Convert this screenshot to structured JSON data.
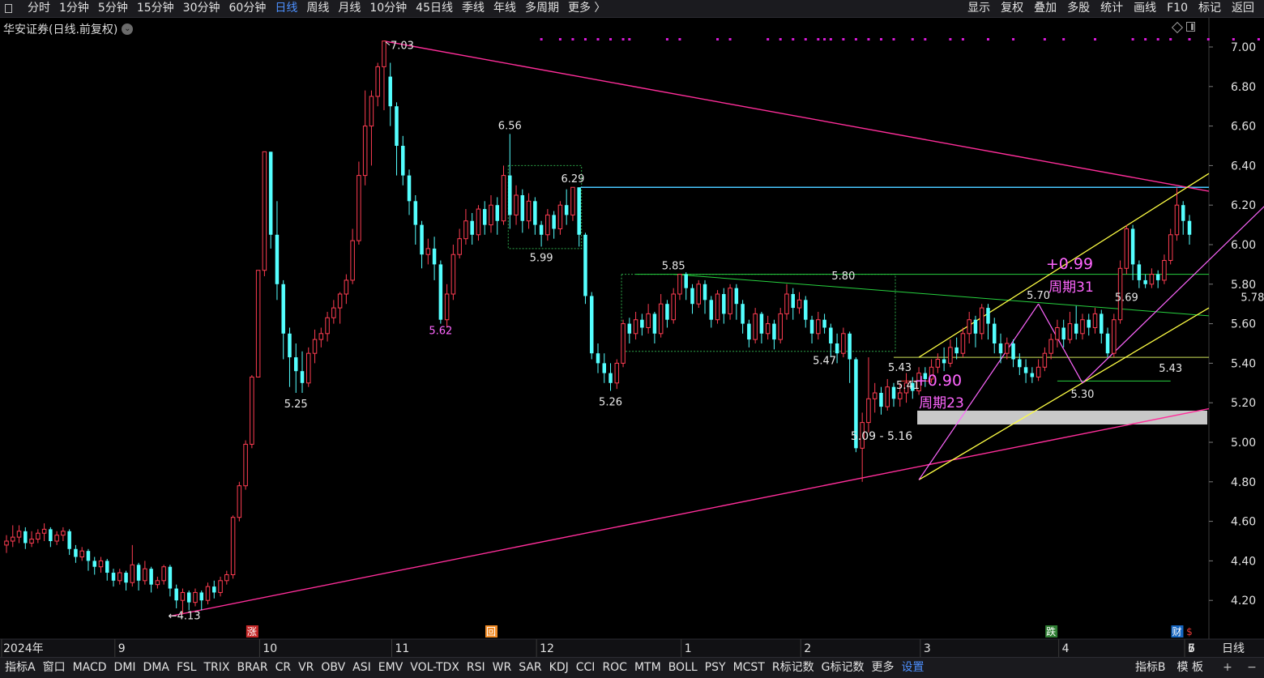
{
  "toolbar": {
    "periods": [
      "分时",
      "1分钟",
      "5分钟",
      "15分钟",
      "30分钟",
      "60分钟",
      "日线",
      "周线",
      "月线",
      "10分钟",
      "45日线",
      "季线",
      "年线",
      "多周期",
      "更多 〉"
    ],
    "active_period": "日线",
    "right_buttons": [
      "显示",
      "复权",
      "叠加",
      "多股",
      "统计",
      "画线",
      "F10",
      "标记",
      "返回"
    ]
  },
  "stock_title": "华安证券(日线.前复权)",
  "axis_period_label": "日线",
  "indicator_tabs": [
    "指标A",
    "窗口",
    "MACD",
    "DMI",
    "DMA",
    "FSL",
    "TRIX",
    "BRAR",
    "CR",
    "VR",
    "OBV",
    "ASI",
    "EMV",
    "VOL-TDX",
    "RSI",
    "WR",
    "SAR",
    "KDJ",
    "CCI",
    "ROC",
    "MTM",
    "BOLL",
    "PSY",
    "MCST",
    "R标记数",
    "G标记数",
    "更多",
    "设置"
  ],
  "indicator_right": [
    "指标B",
    "模 板",
    "+",
    "−"
  ],
  "event_markers": [
    {
      "label": "涨",
      "x_label": "10",
      "color": "#c62828"
    },
    {
      "label": "回",
      "x_label": "12",
      "color": "#f08a24"
    },
    {
      "label": "跌",
      "x_label": "4",
      "color": "#2e7d32"
    },
    {
      "label": "财",
      "x_label": "5",
      "color": "#1565c0"
    },
    {
      "label": "$",
      "x_label": "7",
      "color": "#e53935"
    }
  ],
  "chart_data": {
    "type": "candlestick",
    "ylim": [
      4.1,
      7.1
    ],
    "y_ticks": [
      "7.00",
      "6.80",
      "6.60",
      "6.40",
      "6.20",
      "6.00",
      "5.80",
      "5.60",
      "5.40",
      "5.20",
      "5.00",
      "4.80",
      "4.60",
      "4.40",
      "4.20"
    ],
    "x_labels": [
      "2024年",
      "9",
      "10",
      "11",
      "12",
      "1",
      "2",
      "3",
      "4",
      "5",
      "6",
      "7"
    ],
    "up_color": "#ff3d52",
    "down_color": "#54ffff",
    "candles": [
      [
        4.48,
        4.5,
        4.44,
        4.53
      ],
      [
        4.5,
        4.52,
        4.47,
        4.58
      ],
      [
        4.52,
        4.55,
        4.49,
        4.58
      ],
      [
        4.55,
        4.49,
        4.46,
        4.57
      ],
      [
        4.49,
        4.51,
        4.47,
        4.55
      ],
      [
        4.51,
        4.54,
        4.49,
        4.56
      ],
      [
        4.54,
        4.56,
        4.5,
        4.59
      ],
      [
        4.56,
        4.5,
        4.47,
        4.57
      ],
      [
        4.5,
        4.53,
        4.48,
        4.55
      ],
      [
        4.53,
        4.55,
        4.5,
        4.57
      ],
      [
        4.55,
        4.46,
        4.43,
        4.56
      ],
      [
        4.46,
        4.42,
        4.39,
        4.48
      ],
      [
        4.42,
        4.45,
        4.4,
        4.47
      ],
      [
        4.45,
        4.4,
        4.35,
        4.46
      ],
      [
        4.4,
        4.37,
        4.33,
        4.42
      ],
      [
        4.37,
        4.4,
        4.34,
        4.42
      ],
      [
        4.4,
        4.34,
        4.3,
        4.41
      ],
      [
        4.34,
        4.3,
        4.27,
        4.36
      ],
      [
        4.3,
        4.34,
        4.28,
        4.36
      ],
      [
        4.34,
        4.29,
        4.25,
        4.35
      ],
      [
        4.29,
        4.38,
        4.27,
        4.48
      ],
      [
        4.38,
        4.3,
        4.25,
        4.39
      ],
      [
        4.3,
        4.36,
        4.28,
        4.4
      ],
      [
        4.36,
        4.28,
        4.24,
        4.37
      ],
      [
        4.28,
        4.3,
        4.26,
        4.32
      ],
      [
        4.3,
        4.37,
        4.28,
        4.38
      ],
      [
        4.37,
        4.26,
        4.22,
        4.38
      ],
      [
        4.26,
        4.2,
        4.16,
        4.28
      ],
      [
        4.2,
        4.24,
        4.13,
        4.26
      ],
      [
        4.24,
        4.19,
        4.15,
        4.25
      ],
      [
        4.19,
        4.24,
        4.17,
        4.26
      ],
      [
        4.24,
        4.2,
        4.15,
        4.25
      ],
      [
        4.2,
        4.27,
        4.18,
        4.29
      ],
      [
        4.27,
        4.24,
        4.21,
        4.3
      ],
      [
        4.24,
        4.3,
        4.22,
        4.32
      ],
      [
        4.3,
        4.33,
        4.28,
        4.35
      ],
      [
        4.33,
        4.62,
        4.31,
        4.63
      ],
      [
        4.62,
        4.78,
        4.6,
        4.8
      ],
      [
        4.78,
        4.99,
        4.76,
        5.01
      ],
      [
        4.99,
        5.33,
        4.97,
        5.34
      ],
      [
        5.33,
        5.87,
        5.55,
        5.87
      ],
      [
        5.87,
        6.47,
        5.84,
        6.47
      ],
      [
        6.47,
        6.05,
        5.98,
        6.47
      ],
      [
        6.05,
        5.8,
        5.72,
        6.22
      ],
      [
        5.8,
        5.55,
        5.42,
        5.82
      ],
      [
        5.55,
        5.43,
        5.28,
        5.58
      ],
      [
        5.43,
        5.36,
        5.25,
        5.5
      ],
      [
        5.36,
        5.3,
        5.25,
        5.46
      ],
      [
        5.3,
        5.45,
        5.28,
        5.48
      ],
      [
        5.45,
        5.52,
        5.4,
        5.57
      ],
      [
        5.52,
        5.55,
        5.48,
        5.58
      ],
      [
        5.55,
        5.63,
        5.51,
        5.66
      ],
      [
        5.63,
        5.68,
        5.6,
        5.72
      ],
      [
        5.68,
        5.75,
        5.6,
        5.76
      ],
      [
        5.75,
        5.82,
        5.7,
        5.85
      ],
      [
        5.82,
        6.02,
        5.8,
        6.08
      ],
      [
        6.02,
        6.35,
        6.0,
        6.42
      ],
      [
        6.35,
        6.6,
        6.3,
        6.78
      ],
      [
        6.6,
        6.75,
        6.4,
        6.78
      ],
      [
        6.75,
        6.9,
        6.7,
        6.92
      ],
      [
        6.9,
        7.03,
        6.68,
        7.03
      ],
      [
        6.85,
        6.7,
        6.6,
        6.92
      ],
      [
        6.7,
        6.5,
        6.35,
        6.72
      ],
      [
        6.5,
        6.35,
        6.3,
        6.55
      ],
      [
        6.35,
        6.22,
        6.15,
        6.38
      ],
      [
        6.22,
        6.1,
        6.0,
        6.25
      ],
      [
        6.1,
        5.95,
        5.88,
        6.12
      ],
      [
        5.95,
        5.98,
        5.9,
        6.03
      ],
      [
        5.98,
        5.9,
        5.82,
        6.04
      ],
      [
        5.9,
        5.62,
        5.6,
        5.92
      ],
      [
        5.62,
        5.75,
        5.58,
        5.8
      ],
      [
        5.75,
        5.95,
        5.72,
        6.0
      ],
      [
        5.95,
        6.03,
        5.93,
        6.08
      ],
      [
        6.03,
        6.12,
        6.0,
        6.18
      ],
      [
        6.12,
        6.05,
        6.0,
        6.16
      ],
      [
        6.05,
        6.18,
        6.02,
        6.2
      ],
      [
        6.18,
        6.1,
        6.05,
        6.22
      ],
      [
        6.1,
        6.2,
        6.06,
        6.25
      ],
      [
        6.2,
        6.12,
        6.05,
        6.24
      ],
      [
        6.12,
        6.35,
        6.1,
        6.4
      ],
      [
        6.35,
        6.15,
        6.08,
        6.56
      ],
      [
        6.15,
        6.25,
        6.1,
        6.3
      ],
      [
        6.25,
        6.12,
        6.06,
        6.28
      ],
      [
        6.12,
        6.22,
        6.08,
        6.26
      ],
      [
        6.22,
        6.1,
        6.05,
        6.24
      ],
      [
        6.1,
        6.05,
        5.99,
        6.12
      ],
      [
        6.05,
        6.15,
        6.02,
        6.18
      ],
      [
        6.15,
        6.08,
        6.03,
        6.17
      ],
      [
        6.08,
        6.2,
        6.05,
        6.22
      ],
      [
        6.2,
        6.15,
        6.1,
        6.28
      ],
      [
        6.15,
        6.29,
        6.12,
        6.29
      ],
      [
        6.29,
        6.05,
        5.99,
        6.29
      ],
      [
        6.05,
        5.74,
        5.7,
        6.06
      ],
      [
        5.74,
        5.45,
        5.42,
        5.76
      ],
      [
        5.45,
        5.4,
        5.35,
        5.5
      ],
      [
        5.4,
        5.35,
        5.3,
        5.45
      ],
      [
        5.35,
        5.3,
        5.26,
        5.4
      ],
      [
        5.3,
        5.4,
        5.27,
        5.42
      ],
      [
        5.4,
        5.6,
        5.38,
        5.62
      ],
      [
        5.6,
        5.55,
        5.5,
        5.63
      ],
      [
        5.55,
        5.62,
        5.52,
        5.66
      ],
      [
        5.62,
        5.58,
        5.54,
        5.65
      ],
      [
        5.58,
        5.65,
        5.55,
        5.7
      ],
      [
        5.65,
        5.55,
        5.5,
        5.66
      ],
      [
        5.55,
        5.7,
        5.53,
        5.75
      ],
      [
        5.7,
        5.62,
        5.58,
        5.72
      ],
      [
        5.62,
        5.75,
        5.6,
        5.78
      ],
      [
        5.75,
        5.85,
        5.72,
        5.85
      ],
      [
        5.85,
        5.78,
        5.72,
        5.86
      ],
      [
        5.78,
        5.7,
        5.65,
        5.8
      ],
      [
        5.7,
        5.8,
        5.68,
        5.82
      ],
      [
        5.8,
        5.72,
        5.65,
        5.82
      ],
      [
        5.72,
        5.62,
        5.58,
        5.74
      ],
      [
        5.62,
        5.75,
        5.6,
        5.77
      ],
      [
        5.75,
        5.65,
        5.6,
        5.78
      ],
      [
        5.65,
        5.78,
        5.62,
        5.8
      ],
      [
        5.78,
        5.7,
        5.62,
        5.8
      ],
      [
        5.7,
        5.6,
        5.55,
        5.72
      ],
      [
        5.6,
        5.52,
        5.48,
        5.62
      ],
      [
        5.52,
        5.65,
        5.5,
        5.68
      ],
      [
        5.65,
        5.55,
        5.5,
        5.66
      ],
      [
        5.55,
        5.6,
        5.52,
        5.64
      ],
      [
        5.6,
        5.52,
        5.47,
        5.62
      ],
      [
        5.52,
        5.65,
        5.5,
        5.68
      ],
      [
        5.65,
        5.75,
        5.62,
        5.8
      ],
      [
        5.75,
        5.68,
        5.62,
        5.78
      ],
      [
        5.68,
        5.72,
        5.65,
        5.76
      ],
      [
        5.72,
        5.62,
        5.58,
        5.74
      ],
      [
        5.62,
        5.55,
        5.5,
        5.64
      ],
      [
        5.55,
        5.62,
        5.52,
        5.66
      ],
      [
        5.62,
        5.58,
        5.55,
        5.65
      ],
      [
        5.58,
        5.5,
        5.43,
        5.6
      ],
      [
        5.5,
        5.45,
        5.4,
        5.55
      ],
      [
        5.45,
        5.55,
        5.43,
        5.58
      ],
      [
        5.55,
        5.42,
        5.3,
        5.56
      ],
      [
        5.42,
        4.97,
        4.95,
        5.43
      ],
      [
        4.97,
        5.1,
        4.8,
        5.15
      ],
      [
        5.1,
        5.22,
        5.05,
        5.43
      ],
      [
        5.22,
        5.25,
        5.15,
        5.3
      ],
      [
        5.25,
        5.18,
        5.14,
        5.28
      ],
      [
        5.18,
        5.28,
        5.16,
        5.32
      ],
      [
        5.28,
        5.22,
        5.18,
        5.3
      ],
      [
        5.22,
        5.25,
        5.18,
        5.3
      ],
      [
        5.25,
        5.3,
        5.2,
        5.35
      ],
      [
        5.3,
        5.26,
        5.22,
        5.33
      ],
      [
        5.26,
        5.35,
        5.24,
        5.38
      ],
      [
        5.35,
        5.32,
        5.28,
        5.38
      ],
      [
        5.32,
        5.38,
        5.3,
        5.42
      ],
      [
        5.38,
        5.42,
        5.35,
        5.45
      ],
      [
        5.42,
        5.4,
        5.36,
        5.48
      ],
      [
        5.4,
        5.48,
        5.38,
        5.52
      ],
      [
        5.48,
        5.45,
        5.42,
        5.53
      ],
      [
        5.45,
        5.55,
        5.43,
        5.58
      ],
      [
        5.55,
        5.62,
        5.5,
        5.66
      ],
      [
        5.62,
        5.55,
        5.48,
        5.64
      ],
      [
        5.55,
        5.68,
        5.52,
        5.7
      ],
      [
        5.68,
        5.6,
        5.52,
        5.7
      ],
      [
        5.6,
        5.5,
        5.45,
        5.63
      ],
      [
        5.5,
        5.45,
        5.4,
        5.55
      ],
      [
        5.45,
        5.5,
        5.42,
        5.53
      ],
      [
        5.5,
        5.42,
        5.38,
        5.52
      ],
      [
        5.42,
        5.38,
        5.34,
        5.45
      ],
      [
        5.38,
        5.35,
        5.3,
        5.42
      ],
      [
        5.35,
        5.33,
        5.3,
        5.38
      ],
      [
        5.33,
        5.38,
        5.31,
        5.42
      ],
      [
        5.38,
        5.45,
        5.36,
        5.48
      ],
      [
        5.45,
        5.52,
        5.42,
        5.55
      ],
      [
        5.52,
        5.58,
        5.48,
        5.62
      ],
      [
        5.58,
        5.52,
        5.48,
        5.62
      ],
      [
        5.52,
        5.6,
        5.5,
        5.66
      ],
      [
        5.6,
        5.55,
        5.52,
        5.69
      ],
      [
        5.55,
        5.62,
        5.52,
        5.65
      ],
      [
        5.62,
        5.58,
        5.54,
        5.65
      ],
      [
        5.58,
        5.65,
        5.55,
        5.68
      ],
      [
        5.65,
        5.55,
        5.5,
        5.67
      ],
      [
        5.55,
        5.45,
        5.43,
        5.58
      ],
      [
        5.45,
        5.62,
        5.43,
        5.65
      ],
      [
        5.62,
        5.88,
        5.6,
        5.92
      ],
      [
        5.88,
        6.08,
        5.85,
        6.1
      ],
      [
        6.08,
        5.9,
        5.82,
        6.1
      ],
      [
        5.9,
        5.82,
        5.78,
        5.92
      ],
      [
        5.82,
        5.8,
        5.78,
        5.85
      ],
      [
        5.8,
        5.85,
        5.78,
        5.88
      ],
      [
        5.85,
        5.82,
        5.78,
        5.87
      ],
      [
        5.82,
        5.92,
        5.8,
        5.95
      ],
      [
        5.92,
        6.05,
        5.9,
        6.08
      ],
      [
        6.05,
        6.2,
        6.02,
        6.29
      ],
      [
        6.2,
        6.12,
        6.05,
        6.22
      ],
      [
        6.12,
        6.05,
        6.0,
        6.15
      ]
    ],
    "price_labels": [
      {
        "text": "7.03",
        "bar": 60,
        "price": 7.03,
        "color": "#e8e8e8",
        "arrow": true
      },
      {
        "text": "6.56",
        "bar": 80,
        "price": 6.56,
        "color": "#e8e8e8"
      },
      {
        "text": "6.29",
        "bar": 90,
        "price": 6.29,
        "color": "#e8e8e8"
      },
      {
        "text": "5.99",
        "bar": 85,
        "price": 5.99,
        "color": "#e8e8e8"
      },
      {
        "text": "5.62",
        "bar": 69,
        "price": 5.62,
        "color": "#ff66ff"
      },
      {
        "text": "5.25",
        "bar": 46,
        "price": 5.25,
        "color": "#e8e8e8"
      },
      {
        "text": "5.26",
        "bar": 96,
        "price": 5.26,
        "color": "#e8e8e8"
      },
      {
        "text": "5.85",
        "bar": 106,
        "price": 5.85,
        "color": "#e8e8e8"
      },
      {
        "text": "5.80",
        "bar": 133,
        "price": 5.8,
        "color": "#e8e8e8"
      },
      {
        "text": "5.47",
        "bar": 130,
        "price": 5.47,
        "color": "#e8e8e8"
      },
      {
        "text": "5.43",
        "bar": 143,
        "price": 5.43,
        "color": "#e8e8e8"
      },
      {
        "text": "5.41",
        "bar": 143,
        "price": 5.41,
        "color": "#e8e8e8"
      },
      {
        "text": "4.13",
        "bar": 27,
        "price": 4.13,
        "color": "#e8e8e8",
        "arrow": true
      },
      {
        "text": "5.70",
        "bar": 164,
        "price": 5.7,
        "color": "#e8e8e8"
      },
      {
        "text": "5.69",
        "bar": 178,
        "price": 5.69,
        "color": "#e8e8e8"
      },
      {
        "text": "5.30",
        "bar": 171,
        "price": 5.3,
        "color": "#e8e8e8"
      },
      {
        "text": "5.43",
        "bar": 185,
        "price": 5.43,
        "color": "#e8e8e8"
      },
      {
        "text": "5.78",
        "bar": 197,
        "price": 5.78,
        "color": "#e8e8e8"
      },
      {
        "text": "6.29",
        "bar": 203,
        "price": 6.29,
        "color": "#e8e8e8"
      }
    ],
    "annotations": [
      {
        "text": "+0.90",
        "color": "#ff66ff"
      },
      {
        "text": "周期23",
        "color": "#ff66ff"
      },
      {
        "text": "+0.99",
        "color": "#ff66ff"
      },
      {
        "text": "周期31",
        "color": "#ff66ff"
      },
      {
        "text": "5.09 - 5.16",
        "color": "#e8e8e8"
      }
    ],
    "support_zone": {
      "low": 5.09,
      "high": 5.16,
      "color": "#c8c8c8"
    },
    "resistance_line": {
      "price": 6.29,
      "color": "#49c7ff"
    },
    "horizontal_lines": [
      {
        "price": 5.85,
        "color": "#27d13f"
      },
      {
        "price": 5.43,
        "color": "#cfe45a"
      },
      {
        "price": 5.31,
        "color": "#27d13f"
      },
      {
        "price": 5.31,
        "color": "#e53935"
      }
    ]
  }
}
